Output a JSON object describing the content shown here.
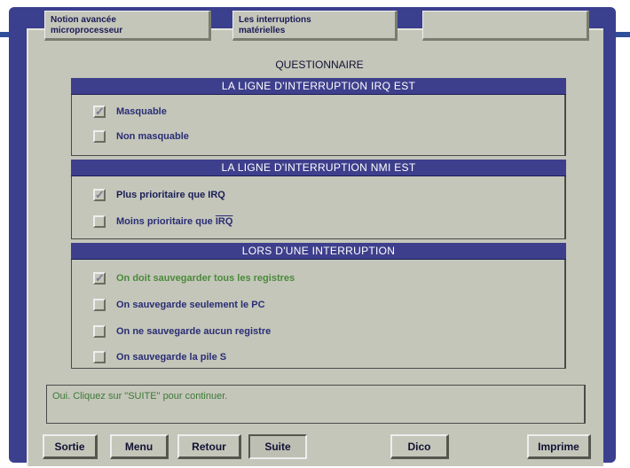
{
  "tabs": [
    {
      "label": "Notion avancée\nmicroprocesseur"
    },
    {
      "label": "Les interruptions\nmatérielles"
    },
    {
      "label": ""
    }
  ],
  "title": "QUESTIONNAIRE",
  "sections": [
    {
      "header": "LA LIGNE D'INTERRUPTION IRQ EST",
      "options": [
        {
          "label": "Masquable",
          "checked": true
        },
        {
          "label": "Non masquable",
          "checked": false
        }
      ]
    },
    {
      "header": "LA LIGNE D'INTERRUPTION NMI EST",
      "options": [
        {
          "label": "Plus prioritaire que IRQ",
          "checked": true
        },
        {
          "label_prefix": "Moins prioritaire que ",
          "label_over": "IRQ",
          "checked": false
        }
      ]
    },
    {
      "header": "LORS D'UNE INTERRUPTION",
      "options": [
        {
          "label": "On doit sauvegarder tous les registres",
          "checked": true
        },
        {
          "label": "On sauvegarde seulement le PC",
          "checked": false
        },
        {
          "label": "On ne sauvegarde aucun registre",
          "checked": false
        },
        {
          "label": "On sauvegarde la pile S",
          "checked": false
        }
      ]
    }
  ],
  "message": "Oui. Cliquez sur \"SUITE\" pour continuer.",
  "buttons": {
    "sortie": "Sortie",
    "menu": "Menu",
    "retour": "Retour",
    "suite": "Suite",
    "dico": "Dico",
    "imprime": "Imprime"
  },
  "colors": {
    "frame": "#3a3f8e",
    "panel": "#c4c6ba",
    "header": "#3e3f8c",
    "correct_text": "#4a8a3a"
  }
}
